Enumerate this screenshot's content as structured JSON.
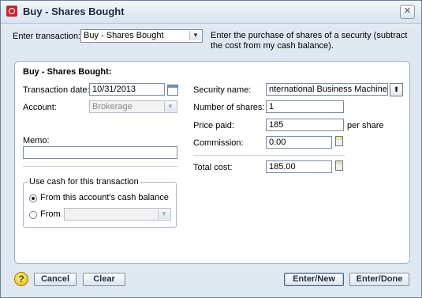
{
  "window": {
    "title": "Buy - Shares Bought",
    "close_glyph": "✕"
  },
  "top": {
    "enter_transaction_label": "Enter transaction:",
    "transaction_type": "Buy - Shares Bought",
    "description": "Enter the purchase of shares of a security (subtract the cost from my cash balance)."
  },
  "panel": {
    "heading": "Buy - Shares Bought:",
    "transaction_date_label": "Transaction date:",
    "transaction_date": "10/31/2013",
    "account_label": "Account:",
    "account_value": "Brokerage",
    "memo_label": "Memo:",
    "memo_value": "",
    "security_name_label": "Security name:",
    "security_name": "nternational Business Machines Corp",
    "number_of_shares_label": "Number of shares:",
    "number_of_shares": "1",
    "price_paid_label": "Price paid:",
    "price_paid": "185",
    "per_share_label": "per share",
    "commission_label": "Commission:",
    "commission": "0.00",
    "total_cost_label": "Total cost:",
    "total_cost": "185.00"
  },
  "cash_group": {
    "title": "Use cash for this transaction",
    "option_this_account": "From this account's cash balance",
    "option_from": "From",
    "from_value": ""
  },
  "buttons": {
    "cancel": "Cancel",
    "clear": "Clear",
    "enter_new": "Enter/New",
    "enter_done": "Enter/Done"
  },
  "icons": {
    "app": "quicken-icon",
    "help": "help-icon",
    "calendar": "calendar-icon",
    "calculator": "calculator-icon",
    "lookup": "lookup-icon"
  },
  "colors": {
    "window_bg": "#dfe7f1",
    "panel_bg": "#ffffff",
    "title_text": "#1b2a3e",
    "app_icon": "#c8262b",
    "help_icon": "#e2b312"
  }
}
